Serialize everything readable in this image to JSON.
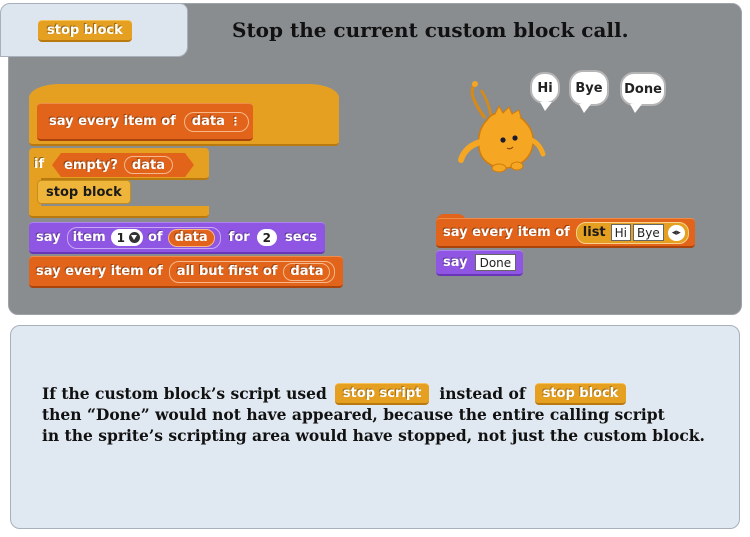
{
  "header": {
    "tab_block_label": "stop block",
    "title": "Stop the current custom block call."
  },
  "definition_script": {
    "hat": {
      "label": "say every item of",
      "param": "data",
      "param_marker": "⋮"
    },
    "if_block": {
      "if_label": "if",
      "predicate": "empty?",
      "predicate_arg": "data"
    },
    "stop_block_label": "stop block",
    "say_block": {
      "say_label": "say",
      "item_label": "item",
      "item_index": "1",
      "of_label": "of",
      "list_arg": "data",
      "for_label": "for",
      "secs_value": "2",
      "secs_label": "secs"
    },
    "recursive_call": {
      "label": "say every item of",
      "reporter": "all but first of",
      "reporter_arg": "data"
    }
  },
  "sprite_script": {
    "call_block": {
      "label": "say every item of",
      "list_label": "list",
      "items": [
        "Hi",
        "Bye"
      ],
      "arrows": "◂▸"
    },
    "say_block": {
      "say_label": "say",
      "value": "Done"
    }
  },
  "stage": {
    "bubbles": [
      "Hi",
      "Bye",
      "Done"
    ]
  },
  "explanation": {
    "line1_pre": "If the custom block’s script used",
    "line1_block_a": "stop script",
    "line1_mid": "instead of",
    "line1_block_b": "stop block",
    "line2": "then “Done” would not have appeared, because the entire calling script",
    "line3": "in the sprite’s scripting area would have stopped, not just the custom block."
  },
  "colors": {
    "panel_gray": "#8a8d90",
    "panel_blue": "#e0e8f1",
    "block_orange": "#e2631a",
    "block_purple": "#8f56e3",
    "block_gold": "#e6a021",
    "sprite_orange": "#f5a623"
  }
}
